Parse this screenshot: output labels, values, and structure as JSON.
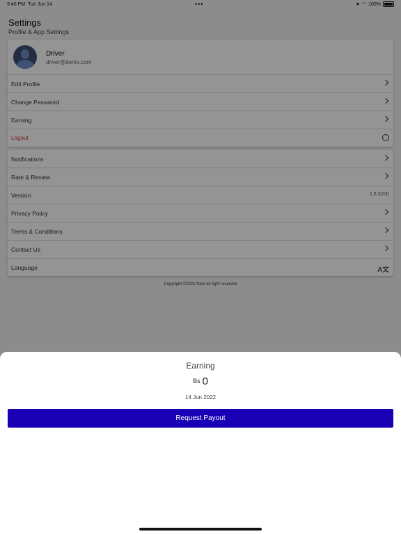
{
  "status_bar": {
    "time": "9:40 PM",
    "date": "Tue Jun 14",
    "battery": "100%"
  },
  "header": {
    "title": "Settings",
    "subtitle": "Profile & App Settings"
  },
  "profile": {
    "name": "Driver",
    "email": "driver@demo.com"
  },
  "account_menu": [
    {
      "label": "Edit Profile"
    },
    {
      "label": "Change Password"
    },
    {
      "label": "Earning"
    },
    {
      "label": "Logout"
    }
  ],
  "app_menu": [
    {
      "label": "Notifications"
    },
    {
      "label": "Rate & Review"
    },
    {
      "label": "Version",
      "value": "1.5.3(33)"
    },
    {
      "label": "Privacy Policy"
    },
    {
      "label": "Terms & Conditions"
    },
    {
      "label": "Contact Us"
    },
    {
      "label": "Language"
    }
  ],
  "copyright": "Copyright ©2022 Next all right reserved",
  "earning_sheet": {
    "title": "Earning",
    "currency": "Bs",
    "amount": "0",
    "date": "14 Jun 2022",
    "button_label": "Request Payout"
  },
  "colors": {
    "accent": "#1900b5",
    "logout": "#d02a2a",
    "overlay": "rgba(0,0,0,0.42)"
  },
  "icons": [
    "wifi-icon",
    "location-icon",
    "battery-icon",
    "chevron-right-icon",
    "logout-icon",
    "language-icon"
  ]
}
